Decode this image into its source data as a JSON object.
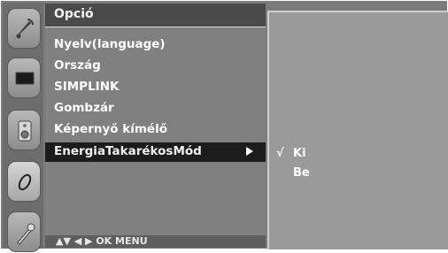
{
  "panel": {
    "title": "Opció",
    "items": [
      {
        "label": "Nyelv(language)"
      },
      {
        "label": "Ország"
      },
      {
        "label": "SIMPLINK"
      },
      {
        "label": "Gombzár"
      },
      {
        "label": "Képernyő  kímélő"
      },
      {
        "label": "EnergiaTakarékosMód"
      }
    ],
    "footer": "▲▼  ◀ ▶  OK  MENU"
  },
  "rail": {
    "icons": [
      "satellite-icon",
      "screen-icon",
      "speaker-icon",
      "option-icon",
      "tool-icon"
    ]
  },
  "options": {
    "check_mark": "√",
    "items": [
      {
        "label": "Ki"
      },
      {
        "label": "Be"
      }
    ]
  }
}
